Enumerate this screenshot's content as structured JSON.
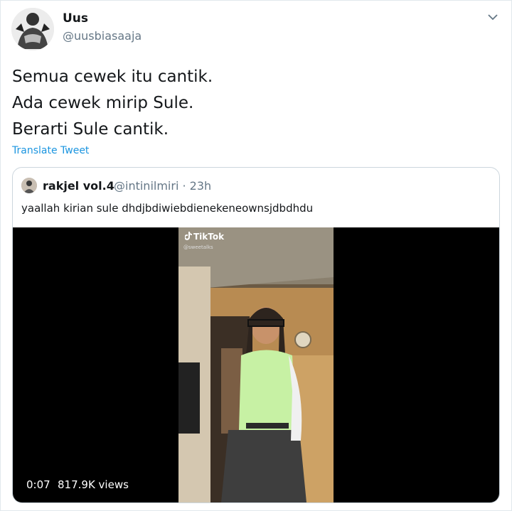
{
  "tweet": {
    "display_name": "Uus",
    "handle": "@uusbiasaaja",
    "lines": [
      "Semua cewek itu cantik.",
      "Ada cewek mirip Sule.",
      "Berarti Sule cantik."
    ],
    "translate_label": "Translate Tweet",
    "link_color": "#1b95e0"
  },
  "quote": {
    "display_name": "rakjel vol.4",
    "meta": "@intinilmiri · 23h",
    "text": "yaallah kirian sule dhdjbdiwiebdienekeneownsjdbdhdu",
    "video": {
      "watermark": "TikTok",
      "watermark_handle": "@sweetalks",
      "time": "0:07",
      "views": "817.9K views"
    }
  },
  "icons": {
    "menu": "chevron-down-icon",
    "tiktok": "tiktok-logo-icon"
  }
}
